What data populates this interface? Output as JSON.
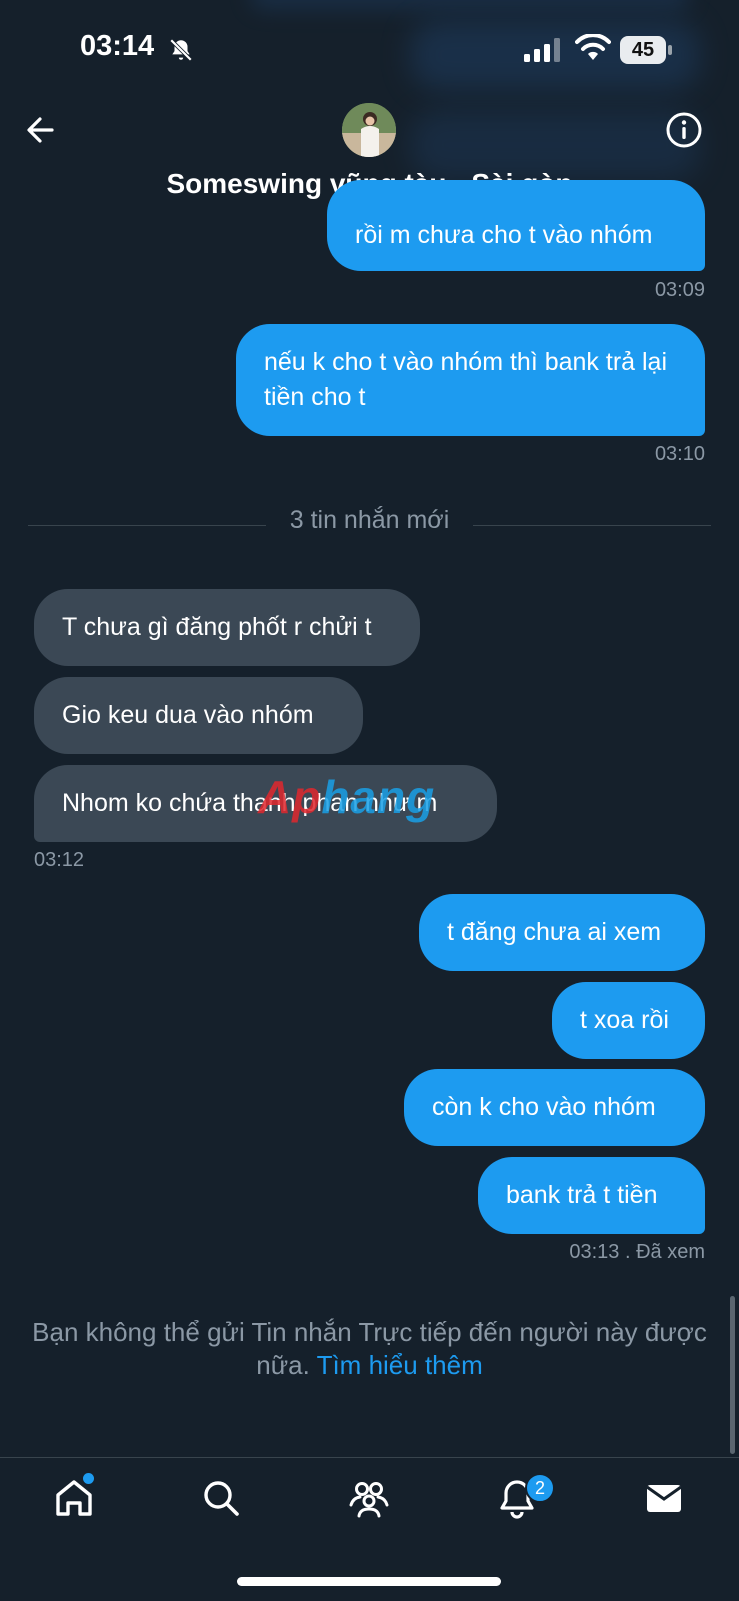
{
  "status_bar": {
    "time": "03:14",
    "battery": "45",
    "icons": [
      "bell-off-icon",
      "signal-icon",
      "wifi-icon",
      "battery-icon"
    ]
  },
  "header": {
    "title": "Someswing vũng tàu - Sài gòn",
    "back_icon": "arrow-left-icon",
    "info_icon": "info-icon"
  },
  "messages": [
    {
      "direction": "outgoing",
      "text": "rồi m chưa cho t vào nhóm",
      "time": "03:09"
    },
    {
      "direction": "outgoing",
      "text": "nếu k cho t vào nhóm thì bank trả lại tiền cho t",
      "time": "03:10"
    },
    {
      "direction": "incoming",
      "text": "T chưa gì đăng phốt r chửi t"
    },
    {
      "direction": "incoming",
      "text": "Gio keu dua vào nhóm"
    },
    {
      "direction": "incoming",
      "text": "Nhom ko chứa thanh phan như m",
      "time": "03:12"
    },
    {
      "direction": "outgoing",
      "text": "t đăng chưa ai xem"
    },
    {
      "direction": "outgoing",
      "text": "t xoa rồi"
    },
    {
      "direction": "outgoing",
      "text": "còn k cho vào nhóm"
    },
    {
      "direction": "outgoing",
      "text": "bank trả t tiền",
      "time": "03:13 . Đã xem"
    }
  ],
  "divider": {
    "label": "3 tin nhắn mới"
  },
  "watermark": {
    "part1": "Ap",
    "part2": "hang"
  },
  "notice": {
    "text": "Bạn không thể gửi Tin nhắn Trực tiếp đến người này được nữa.",
    "link": "Tìm hiểu thêm"
  },
  "nav": {
    "items": [
      {
        "icon": "home-icon",
        "has_dot": true
      },
      {
        "icon": "search-icon"
      },
      {
        "icon": "communities-icon"
      },
      {
        "icon": "notifications-icon",
        "badge": "2"
      },
      {
        "icon": "messages-icon"
      }
    ]
  },
  "colors": {
    "background": "#15202b",
    "outgoing_bubble": "#1d9bf0",
    "incoming_bubble": "#3b4855",
    "muted_text": "#8b98a5",
    "link": "#1d9bf0"
  }
}
